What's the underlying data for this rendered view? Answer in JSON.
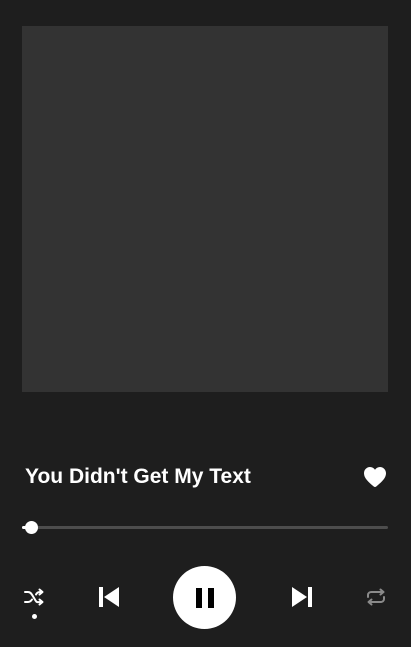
{
  "track": {
    "title": "You Didn't Get My Text",
    "liked": true
  },
  "playback": {
    "progress": 0.02,
    "state": "playing",
    "shuffle": true
  },
  "icons": {
    "like": "heart-icon",
    "shuffle": "shuffle-icon",
    "previous": "skip-previous-icon",
    "pause": "pause-icon",
    "next": "skip-next-icon",
    "repeat": "repeat-icon"
  },
  "colors": {
    "background": "#1e1e1e",
    "album_placeholder": "#333333",
    "foreground": "#ffffff",
    "track_bar": "#4d4d4d"
  }
}
